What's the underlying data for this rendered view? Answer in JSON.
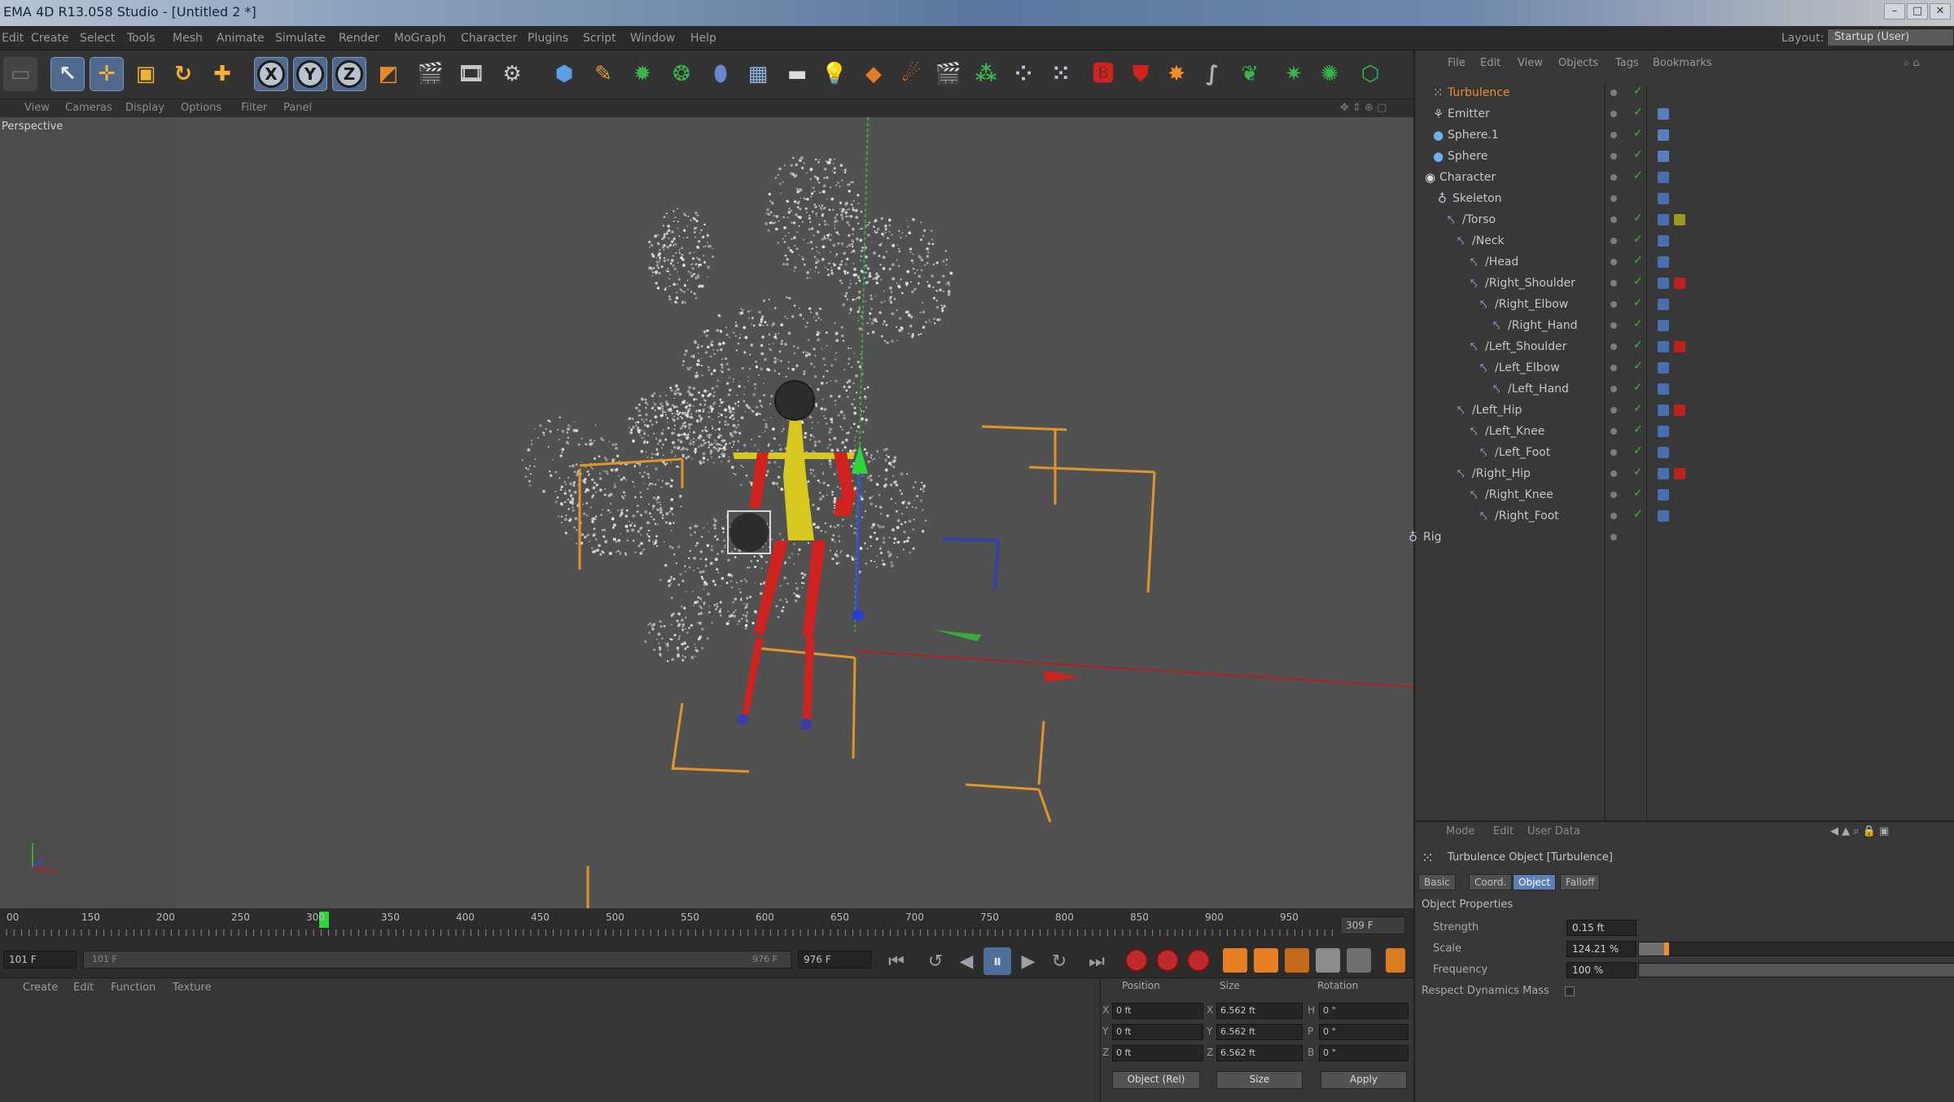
{
  "window": {
    "title": "EMA 4D R13.058 Studio - [Untitled 2 *]"
  },
  "menubar": {
    "items": [
      "Edit",
      "Create",
      "Select",
      "Tools",
      "Mesh",
      "Animate",
      "Simulate",
      "Render",
      "MoGraph",
      "Character",
      "Plugins",
      "Script",
      "Window",
      "Help"
    ],
    "layout_label": "Layout:",
    "layout_value": "Startup (User)"
  },
  "toolbar": {
    "axis_x": "X",
    "axis_y": "Y",
    "axis_z": "Z"
  },
  "viewport": {
    "menu": [
      "View",
      "Cameras",
      "Display",
      "Options",
      "Filter",
      "Panel"
    ],
    "label": "Perspective"
  },
  "timeline": {
    "ticks": [
      "00",
      "150",
      "200",
      "250",
      "300",
      "350",
      "400",
      "450",
      "500",
      "550",
      "600",
      "650",
      "700",
      "750",
      "800",
      "850",
      "900",
      "950"
    ],
    "end_frame": "309 F",
    "playhead_frame": 300
  },
  "transport": {
    "current_frame": "101 F",
    "range_start": "101 F",
    "range_end": "976 F",
    "max_frame": "976 F"
  },
  "material_manager": {
    "menu": [
      "Create",
      "Edit",
      "Function",
      "Texture"
    ]
  },
  "coordinates": {
    "headers": [
      "Position",
      "Size",
      "Rotation"
    ],
    "rows": [
      {
        "axis": "X",
        "pos": "0 ft",
        "size_axis": "X",
        "size": "6.562 ft",
        "rot_axis": "H",
        "rot": "0 °"
      },
      {
        "axis": "Y",
        "pos": "0 ft",
        "size_axis": "Y",
        "size": "6.562 ft",
        "rot_axis": "P",
        "rot": "0 °"
      },
      {
        "axis": "Z",
        "pos": "0 ft",
        "size_axis": "Z",
        "size": "6.562 ft",
        "rot_axis": "B",
        "rot": "0 °"
      }
    ],
    "mode": "Object (Rel)",
    "size_mode": "Size",
    "apply": "Apply"
  },
  "object_manager": {
    "menu": [
      "File",
      "Edit",
      "View",
      "Objects",
      "Tags",
      "Bookmarks"
    ],
    "objects": [
      {
        "name": "Turbulence",
        "active": true
      },
      {
        "name": "Emitter"
      },
      {
        "name": "Sphere.1"
      },
      {
        "name": "Sphere"
      },
      {
        "name": "Character"
      },
      {
        "name": "Skeleton"
      },
      {
        "name": "/Torso"
      },
      {
        "name": "/Neck"
      },
      {
        "name": "/Head"
      },
      {
        "name": "/Right_Shoulder"
      },
      {
        "name": "/Right_Elbow"
      },
      {
        "name": "/Right_Hand"
      },
      {
        "name": "/Left_Shoulder"
      },
      {
        "name": "/Left_Elbow"
      },
      {
        "name": "/Left_Hand"
      },
      {
        "name": "/Left_Hip"
      },
      {
        "name": "/Left_Knee"
      },
      {
        "name": "/Left_Foot"
      },
      {
        "name": "/Right_Hip"
      },
      {
        "name": "/Right_Knee"
      },
      {
        "name": "/Right_Foot"
      },
      {
        "name": "Rig"
      }
    ]
  },
  "attribute_manager": {
    "menu": [
      "Mode",
      "Edit",
      "User Data"
    ],
    "object_title": "Turbulence Object [Turbulence]",
    "tabs": [
      "Basic",
      "Coord.",
      "Object",
      "Falloff"
    ],
    "active_tab": "Object",
    "section": "Object Properties",
    "properties": [
      {
        "label": "Strength",
        "value": "0.15 ft"
      },
      {
        "label": "Scale",
        "value": "124.21 %"
      },
      {
        "label": "Frequency",
        "value": "100 %"
      },
      {
        "label": "Respect Dynamics Mass",
        "value": ""
      }
    ],
    "scale_slider_fraction": 0.08
  },
  "colors": {
    "accent": "#5b7fb7",
    "active_object": "#f08c2a",
    "bone_red": "#d0231f",
    "bone_yellow": "#d6c81f"
  }
}
